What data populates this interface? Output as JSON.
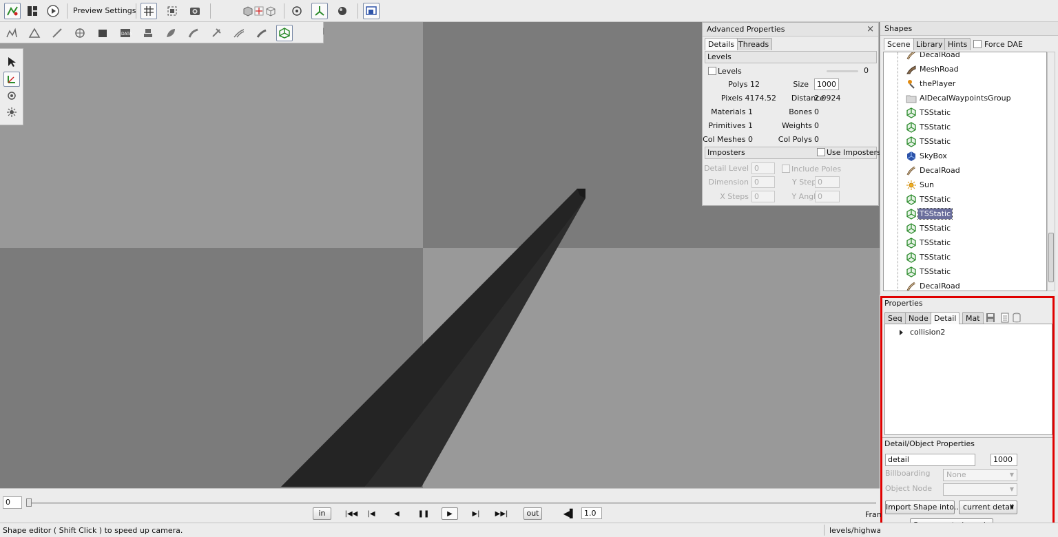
{
  "toolbar": {
    "preview_settings_label": "Preview Settings"
  },
  "advanced": {
    "title": "Advanced Properties",
    "close_glyph": "×",
    "tabs": [
      "Details",
      "Threads"
    ],
    "levels_section": "Levels",
    "levels_checkbox_label": "Levels",
    "levels_value": "0",
    "polys_label": "Polys 12",
    "size_label": "Size",
    "size_value": "1000",
    "pixels_label": "Pixels 4174.52",
    "distance_label": "Distance",
    "distance_value": "2.0924",
    "materials_label": "Materials 1",
    "bones_label": "Bones",
    "bones_value": "0",
    "primitives_label": "Primitives 1",
    "weights_label": "Weights",
    "weights_value": "0",
    "colmeshes_label": "Col Meshes 0",
    "colpolys_label": "Col Polys",
    "colpolys_value": "0",
    "imposters_section": "Imposters",
    "use_imposters_label": "Use Imposters",
    "detail_level_label": "Detail Level",
    "detail_level_value": "0",
    "include_poles_label": "Include Poles",
    "dimension_label": "Dimension",
    "dimension_value": "0",
    "ysteps_label": "Y Steps",
    "ysteps_value": "0",
    "xsteps_label": "X Steps",
    "xsteps_value": "0",
    "yangle_label": "Y Angle",
    "yangle_value": "0"
  },
  "shapes": {
    "title": "Shapes",
    "tabs": [
      "Scene",
      "Library",
      "Hints"
    ],
    "force_dae_label": "Force DAE",
    "items": [
      {
        "label": "DecalRoad",
        "icon": "decal-road-icon"
      },
      {
        "label": "MeshRoad",
        "icon": "mesh-road-icon"
      },
      {
        "label": "thePlayer",
        "icon": "player-icon"
      },
      {
        "label": "AIDecalWaypointsGroup",
        "icon": "folder-icon"
      },
      {
        "label": "TSStatic",
        "icon": "tsstatic-icon"
      },
      {
        "label": "TSStatic",
        "icon": "tsstatic-icon"
      },
      {
        "label": "TSStatic",
        "icon": "tsstatic-icon"
      },
      {
        "label": "SkyBox",
        "icon": "skybox-icon"
      },
      {
        "label": "DecalRoad",
        "icon": "decal-road-icon"
      },
      {
        "label": "Sun",
        "icon": "sun-icon"
      },
      {
        "label": "TSStatic",
        "icon": "tsstatic-icon"
      },
      {
        "label": "TSStatic",
        "icon": "tsstatic-icon",
        "selected": true
      },
      {
        "label": "TSStatic",
        "icon": "tsstatic-icon"
      },
      {
        "label": "TSStatic",
        "icon": "tsstatic-icon"
      },
      {
        "label": "TSStatic",
        "icon": "tsstatic-icon"
      },
      {
        "label": "TSStatic",
        "icon": "tsstatic-icon"
      },
      {
        "label": "DecalRoad",
        "icon": "decal-road-icon"
      }
    ]
  },
  "properties": {
    "title": "Properties",
    "tabs": [
      "Seq",
      "Node",
      "Detail",
      "Mat"
    ],
    "detail_tree_item": "collision2",
    "detail_object_title": "Detail/Object Properties",
    "detail_name_value": "detail",
    "detail_size_value": "1000",
    "billboarding_label": "Billboarding",
    "billboarding_value": "None",
    "object_node_label": "Object Node",
    "object_node_value": "",
    "import_button": "Import Shape into...",
    "current_detail_value": "current detail",
    "recompute_button": "Re-compute bounds"
  },
  "timeline": {
    "current_frame": "0",
    "in_label": "in",
    "out_label": "out",
    "speed_value": "1.0",
    "frame_label_clip": "Fran"
  },
  "status": {
    "message": "Shape editor ( Shift Click ) to speed up camera.",
    "path_clip": "levels/highway"
  },
  "colors": {
    "accent_selection": "#6a6e9c",
    "highlight_border": "#e00000"
  }
}
